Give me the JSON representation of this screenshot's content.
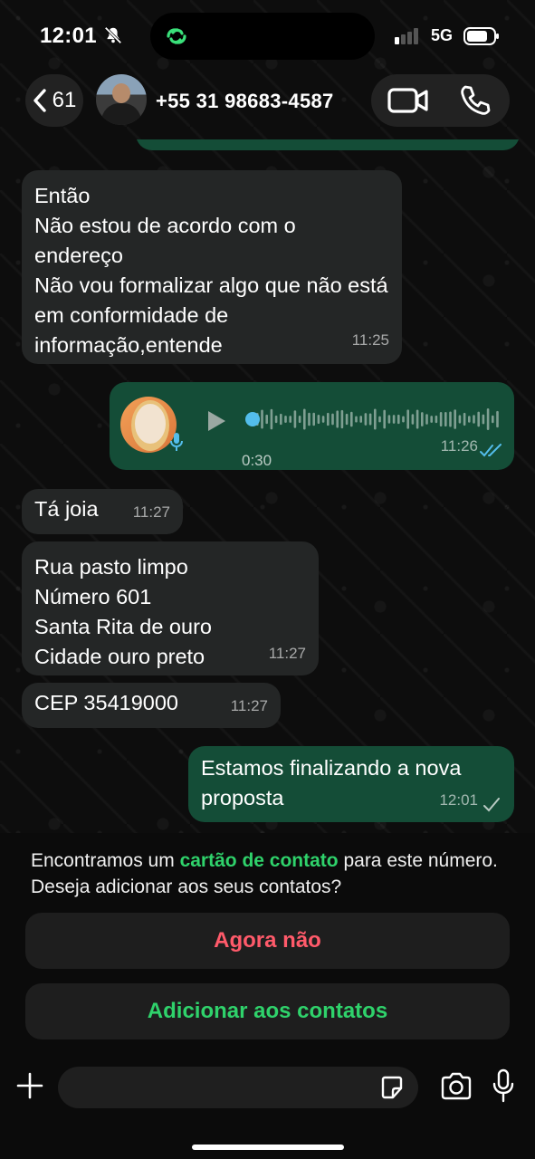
{
  "status_bar": {
    "time": "12:01",
    "network": "5G",
    "icons": [
      "bell-slash-icon",
      "link-icon",
      "signal-icon",
      "battery-icon"
    ]
  },
  "header": {
    "back_count": "61",
    "contact_name": "+55 31 98683-4587",
    "icons": [
      "chevron-left-icon",
      "video-call-icon",
      "phone-icon"
    ]
  },
  "messages": [
    {
      "direction": "in",
      "text": "Então\nNão estou de acordo com o endereço\nNão vou formalizar algo que não está em conformidade de informação,entende",
      "time": "11:25"
    },
    {
      "direction": "out",
      "type": "voice",
      "duration": "0:30",
      "time": "11:26",
      "status": "read",
      "progress": 0
    },
    {
      "direction": "in",
      "text": "Tá joia",
      "time": "11:27"
    },
    {
      "direction": "in",
      "text": "Rua pasto limpo\nNúmero 601\nSanta Rita de ouro\nCidade ouro preto",
      "time": "11:27"
    },
    {
      "direction": "in",
      "text": "CEP 35419000",
      "time": "11:27"
    },
    {
      "direction": "out",
      "text": "Estamos finalizando a nova\nproposta",
      "time": "12:01",
      "status": "sent"
    }
  ],
  "contact_prompt": {
    "text_before": "Encontramos um ",
    "highlight": "cartão de contato",
    "text_after": " para este número. Deseja adicionar aos seus contatos?",
    "not_now_label": "Agora não",
    "add_label": "Adicionar aos contatos"
  },
  "input_bar": {
    "placeholder": "",
    "icons": [
      "plus-icon",
      "sticker-icon",
      "camera-icon",
      "microphone-icon"
    ]
  },
  "colors": {
    "incoming_bubble": "#242626",
    "outgoing_bubble": "#144d37",
    "accent_green": "#2fd26b",
    "danger_red": "#ff5a6a",
    "read_tick": "#53bdeb"
  }
}
